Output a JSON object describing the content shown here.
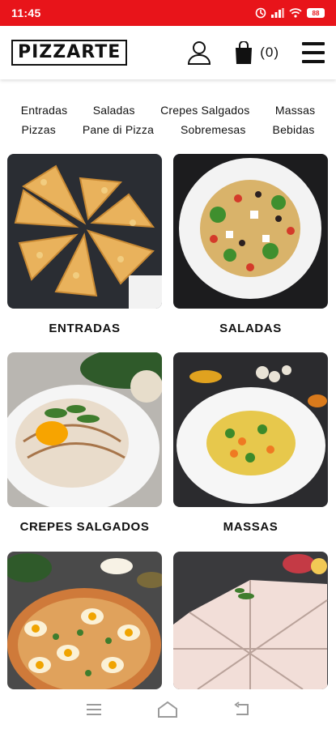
{
  "status_bar": {
    "time": "11:45",
    "battery": "88",
    "icons": [
      "sync-icon",
      "signal-icon",
      "wifi-icon",
      "battery-icon"
    ],
    "color": "#e8141a"
  },
  "header": {
    "logo": "PIZZARTE",
    "cart_count": "(0)",
    "icons": [
      "user-icon",
      "shopping-bag-icon",
      "hamburger-menu-icon"
    ]
  },
  "category_nav": {
    "row1": [
      "Entradas",
      "Saladas",
      "Crepes Salgados",
      "Massas"
    ],
    "row2": [
      "Pizzas",
      "Pane di Pizza",
      "Sobremesas",
      "Bebidas"
    ]
  },
  "categories": [
    {
      "label": "ENTRADAS",
      "image": "pizza-slices-photo"
    },
    {
      "label": "SALADAS",
      "image": "pasta-salad-photo"
    },
    {
      "label": "CREPES SALGADOS",
      "image": "crepe-plate-photo"
    },
    {
      "label": "MASSAS",
      "image": "pasta-bowl-photo"
    },
    {
      "label": "",
      "image": "pizza-photo"
    },
    {
      "label": "",
      "image": "pane-di-pizza-photo"
    }
  ],
  "system_nav": {
    "icons": [
      "recent-apps-icon",
      "home-icon",
      "back-icon"
    ]
  }
}
